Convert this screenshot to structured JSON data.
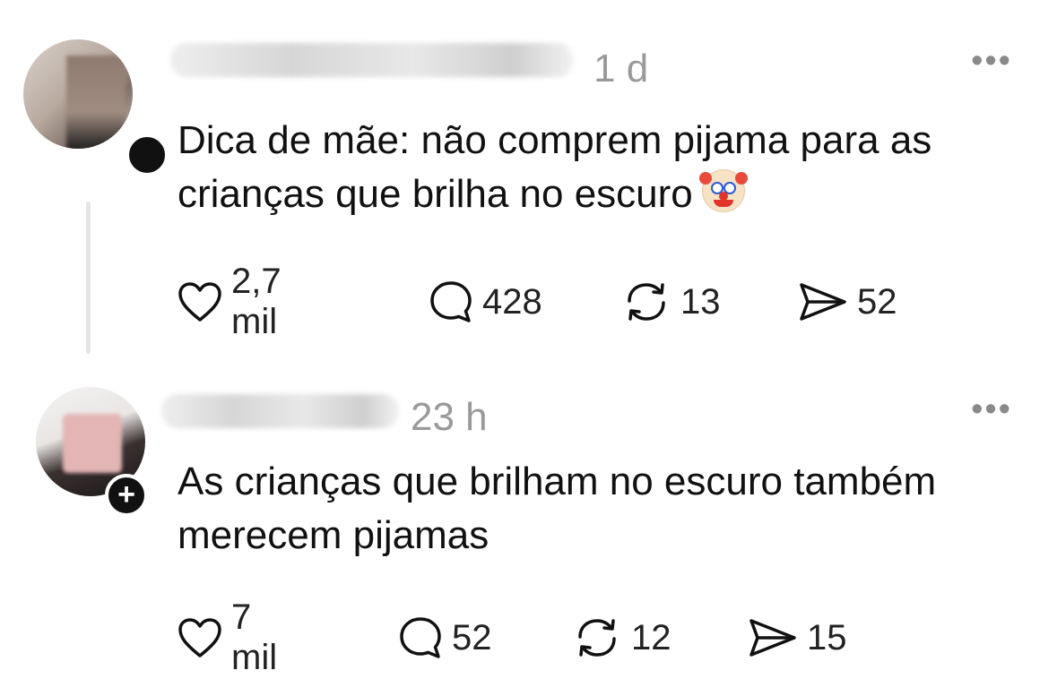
{
  "posts": [
    {
      "time": "1 d",
      "more": "•••",
      "text": "Dica de mãe: não comprem pijama para as crianças que brilha no escuro",
      "emoji": "clown-face",
      "likes": "2,7 mil",
      "replies": "428",
      "reposts": "13",
      "shares": "52"
    },
    {
      "time": "23 h",
      "more": "•••",
      "follow": "+",
      "text": "As crianças que brilham no escuro também merecem pijamas",
      "likes": "7 mil",
      "replies": "52",
      "reposts": "12",
      "shares": "15"
    }
  ]
}
